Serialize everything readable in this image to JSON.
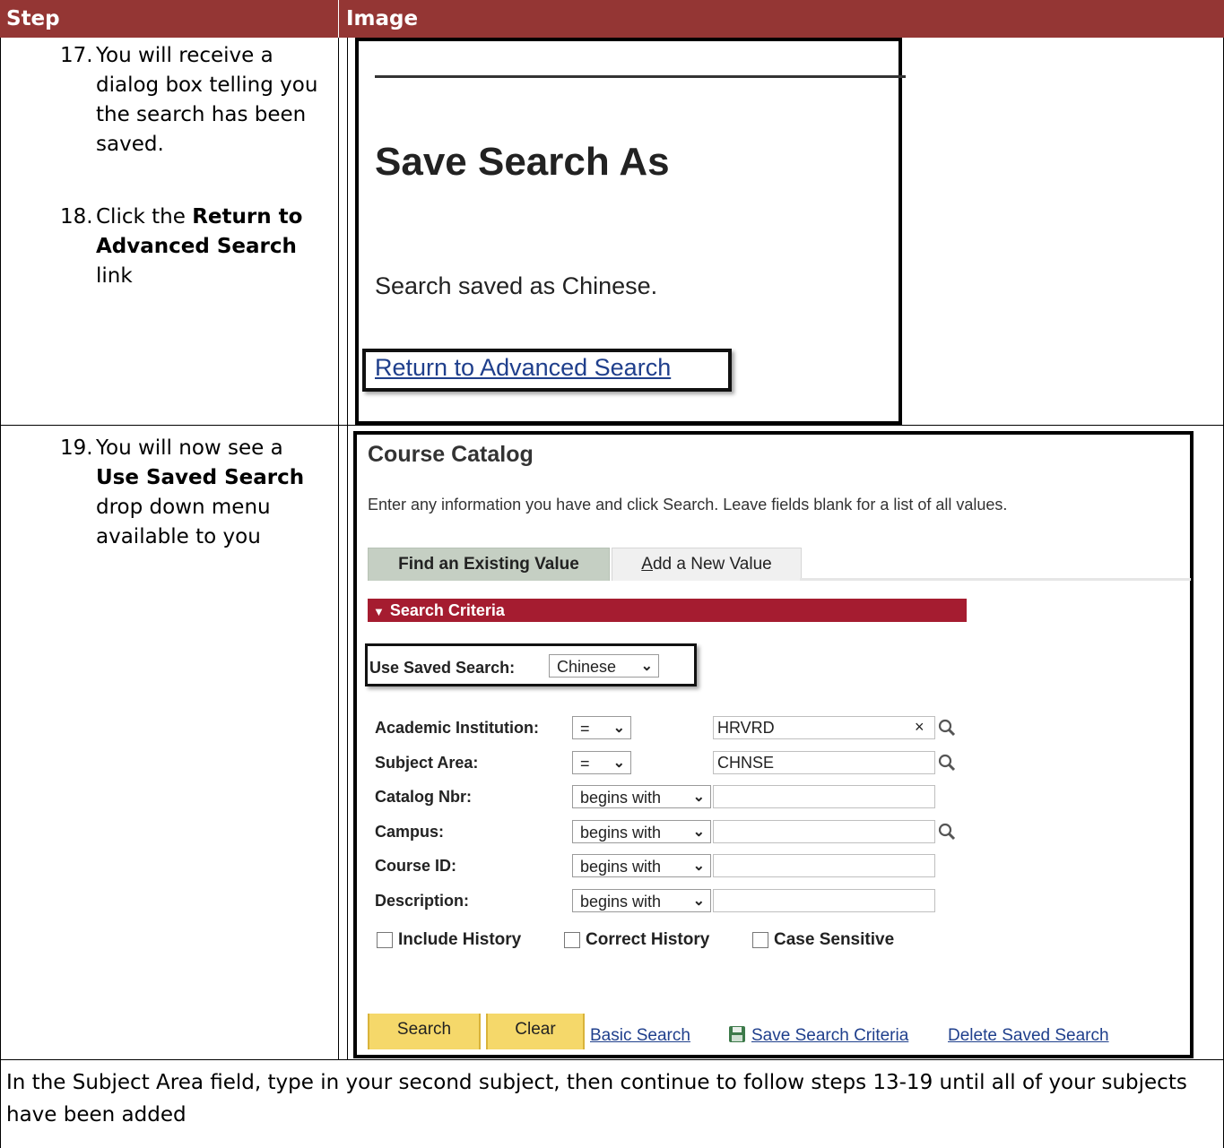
{
  "table": {
    "header": {
      "step": "Step",
      "image": "Image"
    },
    "header_color": "#943634"
  },
  "steps": {
    "s17": {
      "num": "17.",
      "line1": "You will receive a",
      "line2": "dialog box telling you",
      "line3": "the search has been",
      "line4": "saved."
    },
    "s18": {
      "num": "18.",
      "pre": "Click the ",
      "bold1": "Return to",
      "bold2": "Advanced Search",
      "post": " link"
    },
    "s19": {
      "num": "19.",
      "line1": "You will now see a",
      "bold": "Use Saved Search",
      "line3": "drop down menu",
      "line4": "available to you"
    }
  },
  "shot1": {
    "title": "Save Search As",
    "message": "Search saved as Chinese.",
    "link": "Return to Advanced Search"
  },
  "shot2": {
    "title": "Course Catalog",
    "instructions": "Enter any information you have and click Search. Leave fields blank for a list of all values.",
    "tabs": {
      "active": "Find an Existing Value",
      "inactive_access_key": "A",
      "inactive_rest": "dd a New Value"
    },
    "criteria_bar": "Search Criteria",
    "criteria_color": "#a51c30",
    "saved_search": {
      "label": "Use Saved Search:",
      "value": "Chinese"
    },
    "fields": [
      {
        "label": "Academic Institution:",
        "operator": "=",
        "value": "HRVRD",
        "has_clear": true,
        "has_lookup": true
      },
      {
        "label": "Subject Area:",
        "operator": "=",
        "value": "CHNSE",
        "has_lookup": true
      },
      {
        "label": "Catalog Nbr:",
        "operator": "begins with",
        "value": ""
      },
      {
        "label": "Campus:",
        "operator": "begins with",
        "value": "",
        "has_lookup": true
      },
      {
        "label": "Course ID:",
        "operator": "begins with",
        "value": ""
      },
      {
        "label": "Description:",
        "operator": "begins with",
        "value": ""
      }
    ],
    "clear_glyph": "×",
    "checkboxes": {
      "include_history": "Include History",
      "correct_history": "Correct History",
      "case_sensitive": "Case Sensitive"
    },
    "buttons": {
      "search": "Search",
      "clear": "Clear"
    },
    "links": {
      "basic_search": "Basic Search",
      "save_criteria": "Save Search Criteria",
      "delete_saved": "Delete Saved Search"
    },
    "button_color": "#f5d86a"
  },
  "footer": {
    "text": "In the Subject Area field, type in your second subject, then continue to follow steps 13-19 until all of your subjects have been added"
  }
}
